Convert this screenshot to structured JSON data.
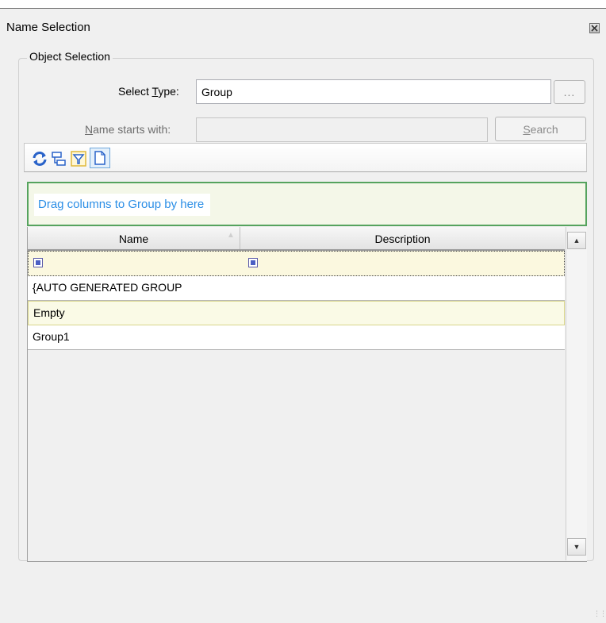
{
  "window": {
    "title": "Name Selection",
    "close_icon": "close-icon"
  },
  "object_selection": {
    "legend": "Object Selection",
    "select_type_label_pre": "Select ",
    "select_type_label_ul": "T",
    "select_type_label_post": "ype:",
    "select_type_value": "Group",
    "browse_label": "...",
    "name_starts_label_ul": "N",
    "name_starts_label_post": "ame starts with:",
    "name_starts_value": "",
    "search_label_ul": "S",
    "search_label_post": "earch"
  },
  "toolbar": {
    "icons": [
      "refresh-icon",
      "group-by-icon",
      "filter-icon",
      "document-icon"
    ]
  },
  "grid": {
    "group_hint": "Drag columns to Group by here",
    "columns": [
      "Name",
      "Description"
    ],
    "sorted_column": "Name",
    "rows": [
      {
        "name": "{AUTO GENERATED GROUP",
        "description": ""
      },
      {
        "name": "Empty",
        "description": ""
      },
      {
        "name": "Group1",
        "description": ""
      }
    ]
  },
  "colors": {
    "group_panel_border": "#55a35e",
    "hint_text": "#2b8ee6",
    "selected_row": "#fafae6"
  }
}
